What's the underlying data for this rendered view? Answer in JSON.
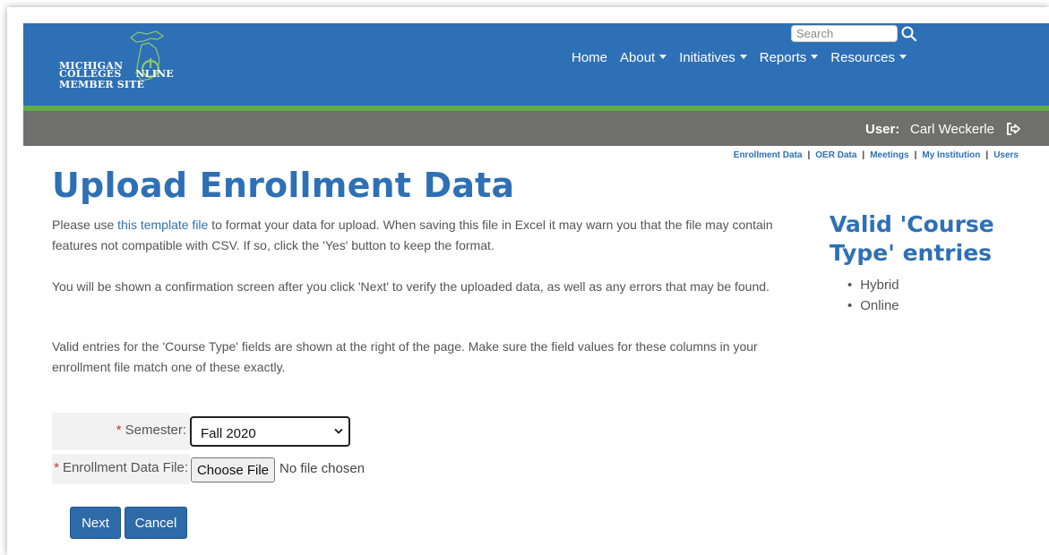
{
  "header": {
    "logo": {
      "line1": "MICHIGAN",
      "line2_prefix": "COLLEGES",
      "line2_suffix": "NLINE",
      "line3": "MEMBER SITE"
    },
    "search": {
      "placeholder": "Search",
      "icon": "search-icon"
    },
    "nav": [
      {
        "label": "Home",
        "dropdown": false
      },
      {
        "label": "About",
        "dropdown": true
      },
      {
        "label": "Initiatives",
        "dropdown": true
      },
      {
        "label": "Reports",
        "dropdown": true
      },
      {
        "label": "Resources",
        "dropdown": true
      }
    ]
  },
  "user_bar": {
    "label": "User:",
    "name": "Carl Weckerle",
    "logout_icon": "sign-out-icon"
  },
  "sub_nav": [
    "Enrollment Data",
    "OER Data",
    "Meetings",
    "My Institution",
    "Users"
  ],
  "page": {
    "title": "Upload Enrollment Data",
    "intro": {
      "before_link": "Please use ",
      "link": "this template file",
      "after_link": " to format your data for upload. When saving this file in Excel it may warn you that the file may contain features not compatible with CSV. If so, click the 'Yes' button to keep the format."
    },
    "para2": "You will be shown a confirmation screen after you click 'Next' to verify the uploaded data, as well as any errors that may be found.",
    "para3": "Valid entries for the 'Course Type' fields are shown at the right of the page. Make sure the field values for these columns in your enrollment file match one of these exactly."
  },
  "sidebar": {
    "title": "Valid 'Course Type' entries",
    "items": [
      "Hybrid",
      "Online"
    ]
  },
  "form": {
    "required_marker": "*",
    "semester_label": "Semester:",
    "semester_value": "Fall 2020",
    "file_label": "Enrollment Data File:",
    "file_button": "Choose File",
    "file_status": "No file chosen",
    "next_button": "Next",
    "cancel_button": "Cancel"
  },
  "colors": {
    "header_blue": "#2e70b5",
    "green_stripe": "#5ead46",
    "user_bar_gray": "#6f6f6e",
    "button_blue": "#2e6aa8"
  }
}
